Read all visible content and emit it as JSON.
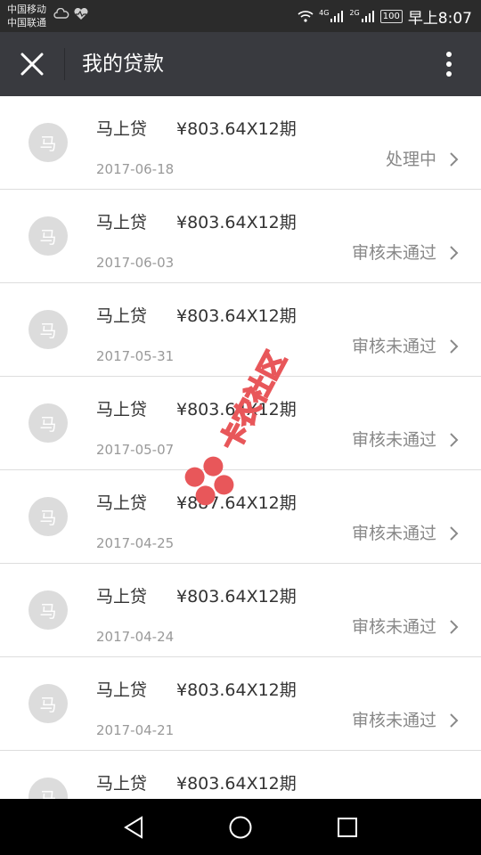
{
  "status_bar": {
    "carrier_1": "中国移动",
    "carrier_2": "中国联通",
    "signal_1_label": "4G",
    "signal_2_label": "2G",
    "battery": "100",
    "time": "早上8:07",
    "icons": [
      "cloud-icon",
      "heart-monitor-icon",
      "wifi-icon",
      "signal-icon",
      "battery-icon"
    ]
  },
  "app_bar": {
    "title": "我的贷款",
    "icons": [
      "close-icon",
      "more-vertical-icon"
    ]
  },
  "loans": [
    {
      "avatar": "马",
      "lender": "马上贷",
      "amount": "¥803.64X12期",
      "date": "2017-06-18",
      "status": "处理中"
    },
    {
      "avatar": "马",
      "lender": "马上贷",
      "amount": "¥803.64X12期",
      "date": "2017-06-03",
      "status": "审核未通过"
    },
    {
      "avatar": "马",
      "lender": "马上贷",
      "amount": "¥803.64X12期",
      "date": "2017-05-31",
      "status": "审核未通过"
    },
    {
      "avatar": "马",
      "lender": "马上贷",
      "amount": "¥803.64X12期",
      "date": "2017-05-07",
      "status": "审核未通过"
    },
    {
      "avatar": "马",
      "lender": "马上贷",
      "amount": "¥887.64X12期",
      "date": "2017-04-25",
      "status": "审核未通过"
    },
    {
      "avatar": "马",
      "lender": "马上贷",
      "amount": "¥803.64X12期",
      "date": "2017-04-24",
      "status": "审核未通过"
    },
    {
      "avatar": "马",
      "lender": "马上贷",
      "amount": "¥803.64X12期",
      "date": "2017-04-21",
      "status": "审核未通过"
    },
    {
      "avatar": "马",
      "lender": "马上贷",
      "amount": "¥803.64X12期",
      "date": "",
      "status": ""
    }
  ],
  "watermark": {
    "text": "卡农社区",
    "icon": "kanong-logo-icon",
    "color": "#e8575a"
  },
  "nav_bar": {
    "icons": [
      "back-triangle-icon",
      "home-circle-icon",
      "recents-square-icon"
    ]
  },
  "colors": {
    "status_bar_bg": "#2b2b2b",
    "app_bar_bg": "#393a3f",
    "avatar_bg": "#dcdcdc",
    "nav_bar_bg": "#000000"
  }
}
